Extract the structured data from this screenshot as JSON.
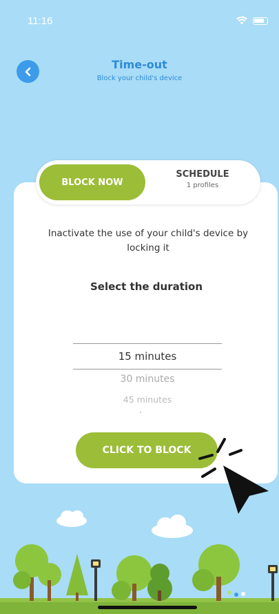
{
  "status_bar": {
    "time": "11:16"
  },
  "header": {
    "title": "Time-out",
    "subtitle": "Block your child's device"
  },
  "tabs": {
    "active_label": "BLOCK NOW",
    "other_label": "SCHEDULE",
    "other_sub": "1 profiles"
  },
  "main": {
    "description": "Inactivate the use of your child's device by locking it",
    "duration_title": "Select the duration",
    "options": [
      "15 minutes",
      "30 minutes",
      "45 minutes"
    ],
    "selected_option": "15 minutes",
    "block_button": "CLICK TO BLOCK"
  },
  "colors": {
    "sky": "#a9dcf6",
    "accent_green": "#9cbd37",
    "title_blue": "#2e8bd6",
    "back_button_blue": "#3d9be9"
  },
  "icons": [
    "chevron-left-icon",
    "wifi-icon",
    "battery-icon",
    "pointer-cursor-icon"
  ]
}
